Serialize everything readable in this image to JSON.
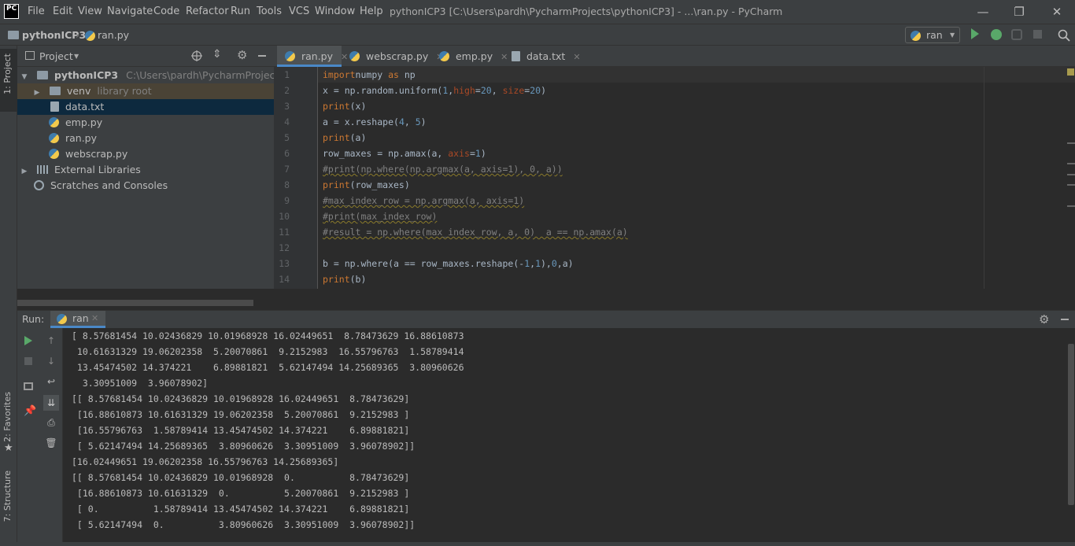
{
  "menu": {
    "items": [
      "File",
      "Edit",
      "View",
      "Navigate",
      "Code",
      "Refactor",
      "Run",
      "Tools",
      "VCS",
      "Window",
      "Help"
    ],
    "logo": "PC"
  },
  "window": {
    "title": "pythonICP3 [C:\\Users\\pardh\\PycharmProjects\\pythonICP3] - ...\\ran.py - PyCharm",
    "minimize": "—",
    "restore": "❐",
    "close": "✕"
  },
  "breadcrumb": {
    "project": "pythonICP3",
    "file": "ran.py"
  },
  "run_config": {
    "selected": "ran"
  },
  "side_tabs": {
    "project": "1: Project",
    "favorites": "2: Favorites",
    "structure": "7: Structure"
  },
  "project_panel": {
    "title": "Project",
    "root_name": "pythonICP3",
    "root_path": "C:\\Users\\pardh\\PycharmProjects\\python",
    "venv_name": "venv",
    "venv_hint": "library root",
    "files": [
      "data.txt",
      "emp.py",
      "ran.py",
      "webscrap.py"
    ],
    "external": "External Libraries",
    "scratches": "Scratches and Consoles"
  },
  "tabs": [
    "ran.py",
    "webscrap.py",
    "emp.py",
    "data.txt"
  ],
  "editor": {
    "line_numbers": [
      "1",
      "2",
      "3",
      "4",
      "5",
      "6",
      "7",
      "8",
      "9",
      "10",
      "11",
      "12",
      "13",
      "14"
    ]
  },
  "run_panel": {
    "label": "Run:",
    "tab": "ran",
    "output": [
      "[ 8.57681454 10.02436829 10.01968928 16.02449651  8.78473629 16.88610873",
      " 10.61631329 19.06202358  5.20070861  9.2152983  16.55796763  1.58789414",
      " 13.45474502 14.374221    6.89881821  5.62147494 14.25689365  3.80960626",
      "  3.30951009  3.96078902]",
      "[[ 8.57681454 10.02436829 10.01968928 16.02449651  8.78473629]",
      " [16.88610873 10.61631329 19.06202358  5.20070861  9.2152983 ]",
      " [16.55796763  1.58789414 13.45474502 14.374221    6.89881821]",
      " [ 5.62147494 14.25689365  3.80960626  3.30951009  3.96078902]]",
      "[16.02449651 19.06202358 16.55796763 14.25689365]",
      "[[ 8.57681454 10.02436829 10.01968928  0.          8.78473629]",
      " [16.88610873 10.61631329  0.          5.20070861  9.2152983 ]",
      " [ 0.          1.58789414 13.45474502 14.374221    6.89881821]",
      " [ 5.62147494  0.          3.80960626  3.30951009  3.96078902]]"
    ]
  },
  "colors": {
    "background": "#2b2b2b",
    "panel": "#3c3f41",
    "selection": "#0d293e",
    "keyword": "#cc7832",
    "number": "#6897bb",
    "param": "#aa4926",
    "comment": "#808080",
    "run_green": "#59a869"
  },
  "icons": [
    "pycharm-logo-icon",
    "python-file-icon",
    "run-icon",
    "debug-icon",
    "coverage-icon",
    "stop-icon",
    "search-icon",
    "globe-icon",
    "collapse-icon",
    "gear-icon",
    "minimize-panel-icon",
    "rerun-icon",
    "up-icon",
    "down-icon",
    "soft-wrap-icon",
    "scroll-end-icon",
    "print-icon",
    "trash-icon",
    "pin-icon",
    "favorites-star-icon",
    "folder-icon",
    "library-icon",
    "scratches-icon"
  ]
}
